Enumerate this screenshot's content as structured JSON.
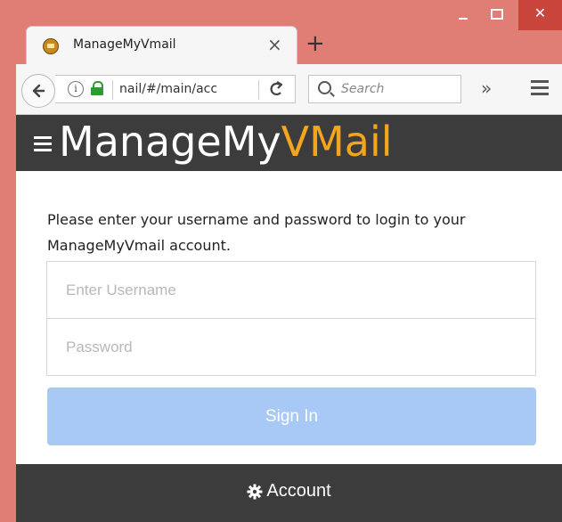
{
  "browser": {
    "tab": {
      "title": "ManageMyVmail",
      "close_glyph": "×",
      "favicon": "mail-favicon"
    },
    "new_tab_glyph": "+",
    "window_controls": {
      "close_glyph": "✕"
    },
    "nav": {
      "back_glyph": "←",
      "url": "nail/#/main/acc",
      "reload_glyph": "C",
      "search_placeholder": "Search",
      "overflow_glyph": "»"
    },
    "icons": [
      "info-icon",
      "lock-icon",
      "reload-icon",
      "search-icon",
      "menu-icon"
    ]
  },
  "app": {
    "title_prefix": "ManageMy",
    "title_suffix": "VMail",
    "accent_color": "#f3a51d",
    "header_bg": "#3c3c3c",
    "menu_icon": "hamburger-icon"
  },
  "login": {
    "instructions": "Please enter your username and password to login to your ManageMyVmail account.",
    "username_placeholder": "Enter Username",
    "password_placeholder": "Password",
    "signin_label": "Sign In",
    "signin_color": "#a8c8f5"
  },
  "footer": {
    "account_label": "Account",
    "account_icon": "gear-icon"
  }
}
